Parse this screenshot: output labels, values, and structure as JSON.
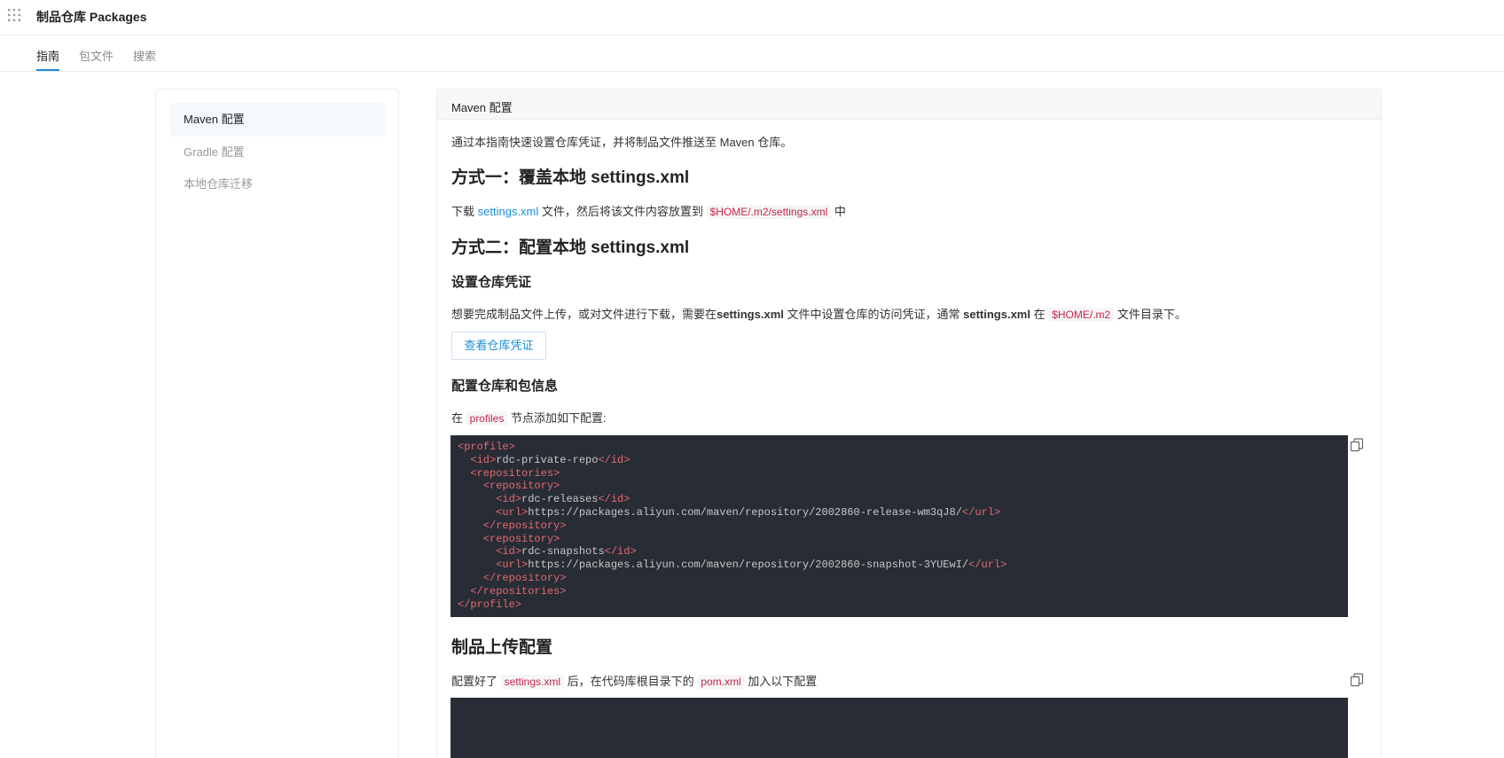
{
  "app": {
    "title": "制品仓库 Packages",
    "grid_icon": "apps-grid-icon"
  },
  "tabs": [
    {
      "label": "指南",
      "active": true
    },
    {
      "label": "包文件",
      "active": false
    },
    {
      "label": "搜索",
      "active": false
    }
  ],
  "sidebar": {
    "items": [
      {
        "label": "Maven 配置",
        "active": true
      },
      {
        "label": "Gradle 配置",
        "active": false
      },
      {
        "label": "本地仓库迁移",
        "active": false
      }
    ]
  },
  "main": {
    "header_title": "Maven 配置",
    "intro": "通过本指南快速设置仓库凭证，并将制品文件推送至 Maven 仓库。",
    "method1": {
      "title": "方式一：覆盖本地 settings.xml",
      "text_pre": "下载",
      "link": "settings.xml",
      "text_mid": "文件，然后将该文件内容放置到",
      "path": "$HOME/.m2/settings.xml",
      "text_post": "中"
    },
    "method2": {
      "title": "方式二：配置本地 settings.xml",
      "cred_title": "设置仓库凭证",
      "cred_text_1": "想要完成制品文件上传，或对文件进行下载，需要在",
      "cred_bold_1": "settings.xml",
      "cred_text_2": " 文件中设置仓库的访问凭证，通常 ",
      "cred_bold_2": "settings.xml",
      "cred_text_3": " 在 ",
      "cred_path": "$HOME/.m2",
      "cred_text_4": " 文件目录下。",
      "view_button": "查看仓库凭证",
      "repo_title": "配置仓库和包信息",
      "profiles_pre": "在",
      "profiles_code": "profiles",
      "profiles_post": "节点添加如下配置:"
    },
    "code_lines": [
      [
        [
          "t",
          "<profile>"
        ]
      ],
      [
        [
          "p",
          "  "
        ],
        [
          "t",
          "<id>"
        ],
        [
          "p",
          "rdc-private-repo"
        ],
        [
          "t",
          "</id>"
        ]
      ],
      [
        [
          "p",
          "  "
        ],
        [
          "t",
          "<repositories>"
        ]
      ],
      [
        [
          "p",
          "    "
        ],
        [
          "t",
          "<repository>"
        ]
      ],
      [
        [
          "p",
          "      "
        ],
        [
          "t",
          "<id>"
        ],
        [
          "p",
          "rdc-releases"
        ],
        [
          "t",
          "</id>"
        ]
      ],
      [
        [
          "p",
          "      "
        ],
        [
          "t",
          "<url>"
        ],
        [
          "p",
          "https://packages.aliyun.com/maven/repository/2002860-release-wm3qJ8/"
        ],
        [
          "t",
          "</url>"
        ]
      ],
      [
        [
          "p",
          "    "
        ],
        [
          "t",
          "</repository>"
        ]
      ],
      [
        [
          "p",
          "    "
        ],
        [
          "t",
          "<repository>"
        ]
      ],
      [
        [
          "p",
          "      "
        ],
        [
          "t",
          "<id>"
        ],
        [
          "p",
          "rdc-snapshots"
        ],
        [
          "t",
          "</id>"
        ]
      ],
      [
        [
          "p",
          "      "
        ],
        [
          "t",
          "<url>"
        ],
        [
          "p",
          "https://packages.aliyun.com/maven/repository/2002860-snapshot-3YUEwI/"
        ],
        [
          "t",
          "</url>"
        ]
      ],
      [
        [
          "p",
          "    "
        ],
        [
          "t",
          "</repository>"
        ]
      ],
      [
        [
          "p",
          "  "
        ],
        [
          "t",
          "</repositories>"
        ]
      ],
      [
        [
          "t",
          "</profile>"
        ]
      ]
    ],
    "upload": {
      "title": "制品上传配置",
      "text_pre": "配置好了",
      "code1": "settings.xml",
      "text_mid": "后，在代码库根目录下的",
      "code2": "pom.xml",
      "text_post": "加入以下配置"
    }
  },
  "colors": {
    "accent": "#1b8fd8",
    "code_bg": "#282c34",
    "code_tag": "#e06c75",
    "inline_code": "#c7254e"
  },
  "icons": {
    "copy": "copy-icon"
  }
}
